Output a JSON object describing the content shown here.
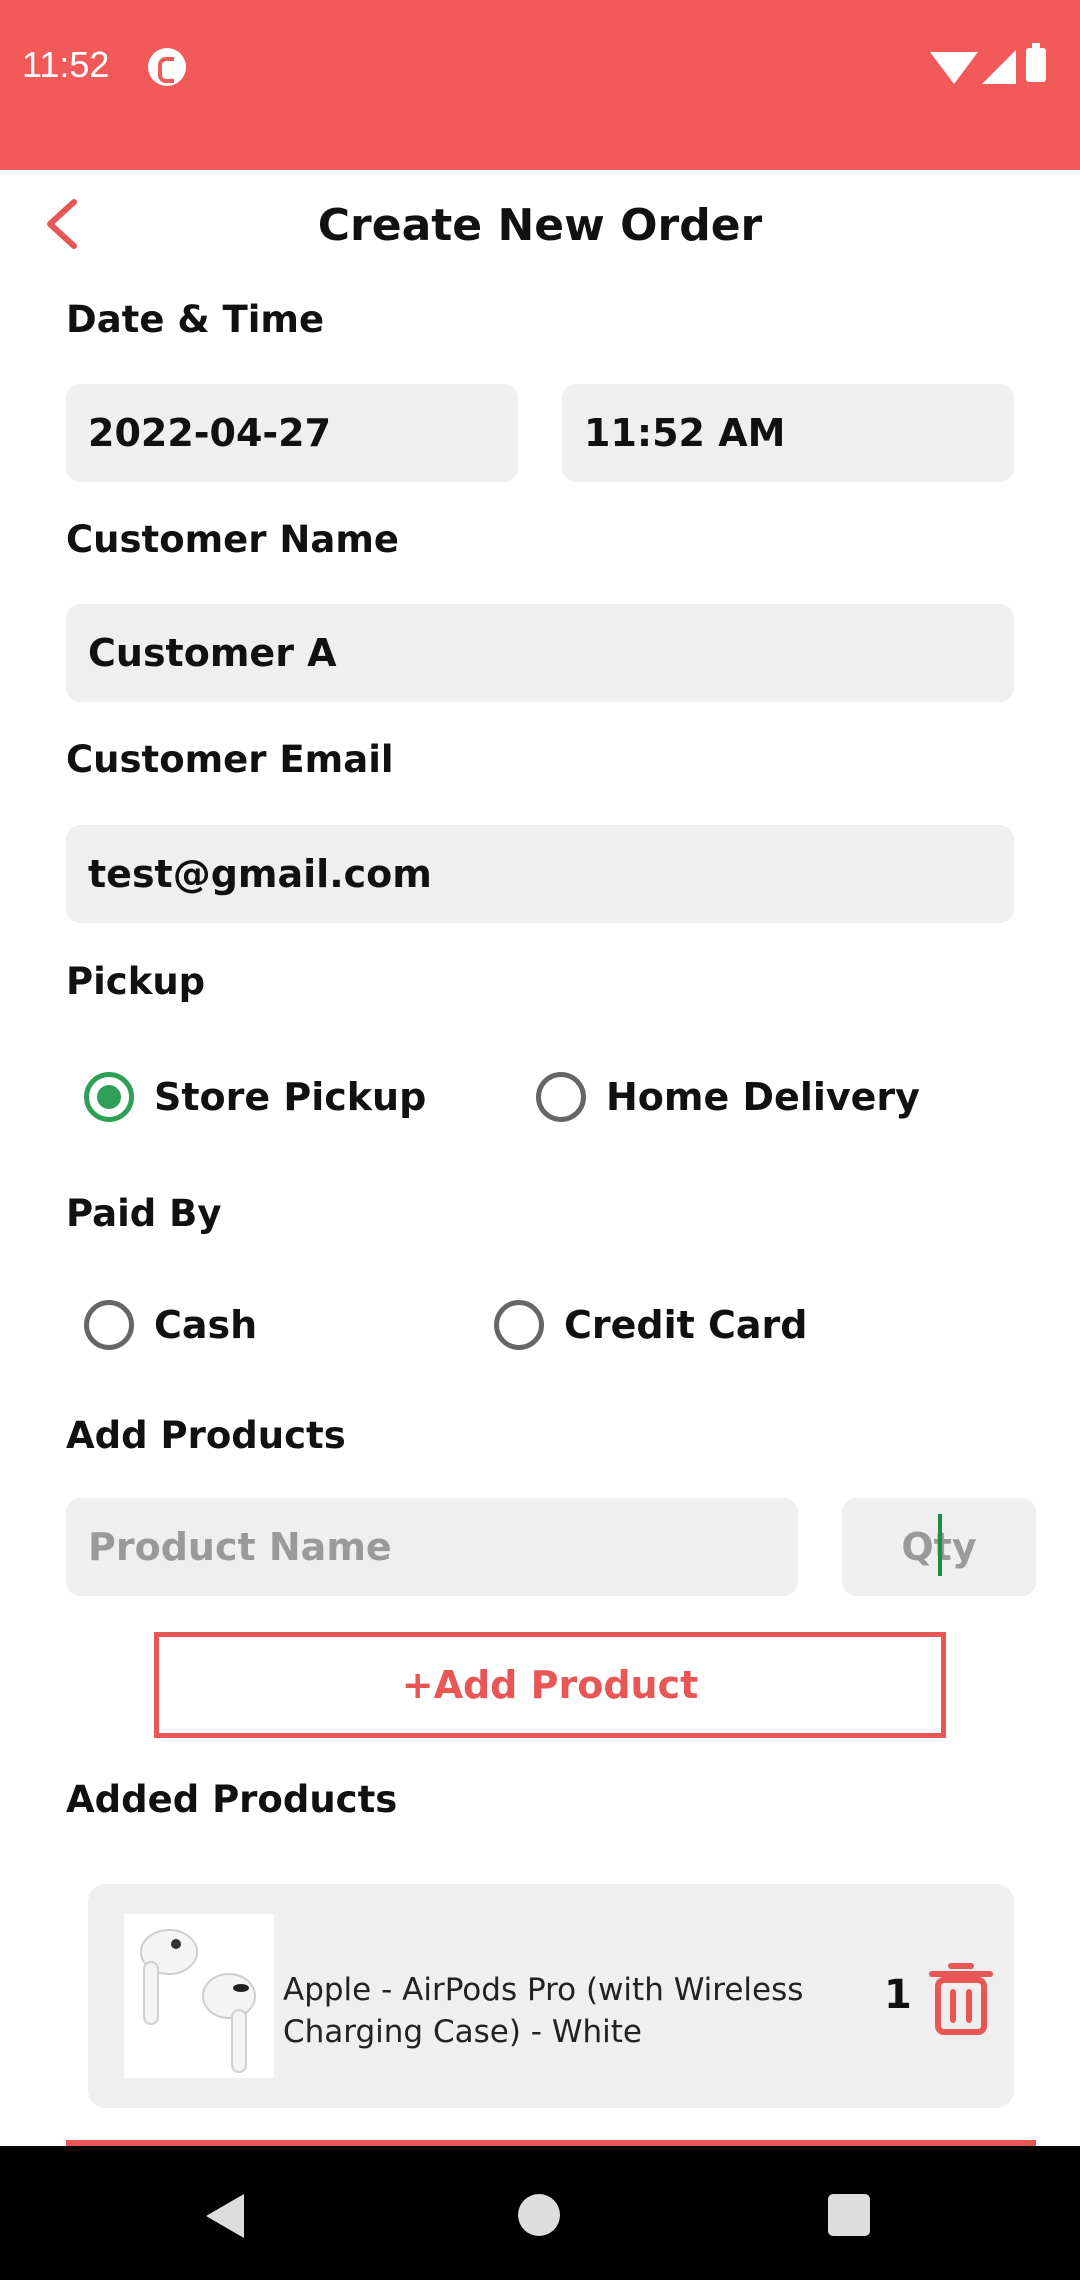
{
  "status_bar": {
    "time": "11:52"
  },
  "header": {
    "title": "Create New Order"
  },
  "form": {
    "date_time_label": "Date & Time",
    "date_value": "2022-04-27",
    "time_value": "11:52 AM",
    "customer_name_label": "Customer Name",
    "customer_name_value": "Customer A",
    "customer_email_label": "Customer Email",
    "customer_email_value": "test@gmail.com",
    "pickup_label": "Pickup",
    "pickup_options": [
      {
        "label": "Store Pickup",
        "selected": true
      },
      {
        "label": "Home Delivery",
        "selected": false
      }
    ],
    "paid_by_label": "Paid By",
    "paid_by_options": [
      {
        "label": "Cash",
        "selected": false
      },
      {
        "label": "Credit Card",
        "selected": false
      }
    ],
    "add_products_label": "Add Products",
    "product_name_placeholder": "Product Name",
    "qty_placeholder": "Qty",
    "add_product_button": "+Add Product",
    "added_products_label": "Added Products"
  },
  "added_products": [
    {
      "name": "Apple - AirPods Pro (with Wireless Charging Case) - White",
      "qty": "1"
    }
  ],
  "colors": {
    "accent": "#f25a5a",
    "radio_selected": "#2f9e58",
    "field_bg": "#efefef"
  }
}
